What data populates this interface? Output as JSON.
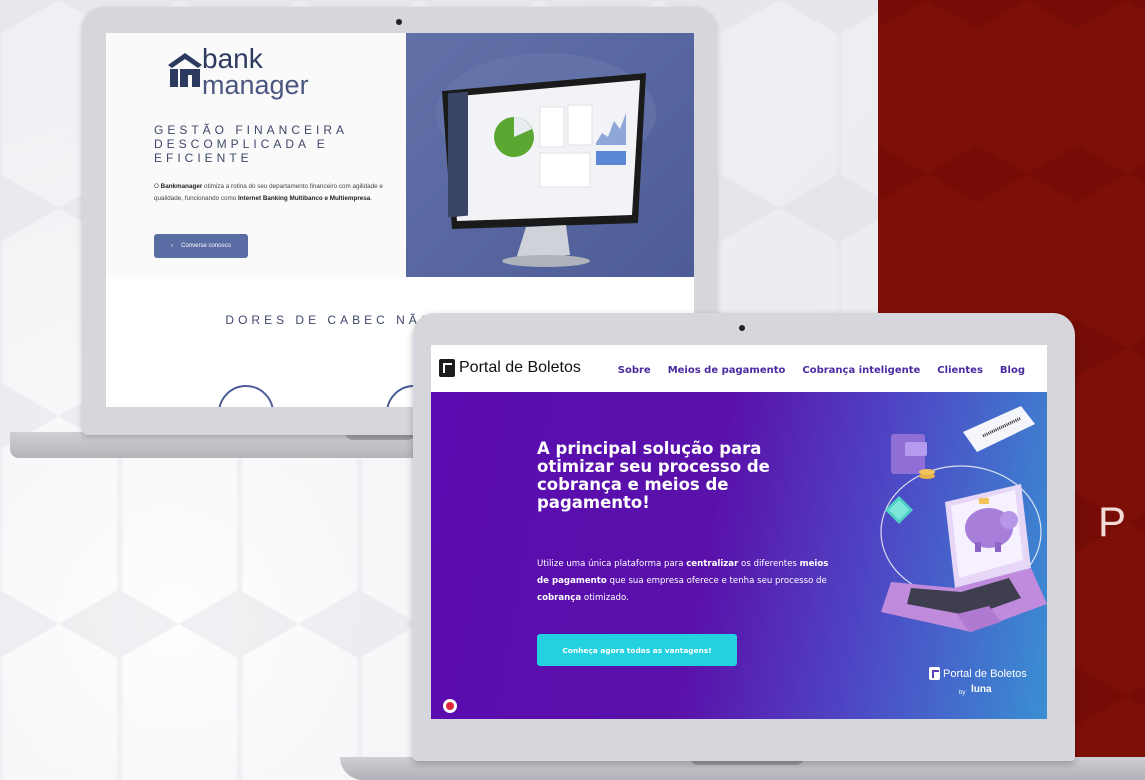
{
  "bankmanager": {
    "logo_line1": "bank",
    "logo_line2": "manager",
    "tagline": "GESTÃO FINANCEIRA DESCOMPLICADA E EFICIENTE",
    "description_parts": {
      "p1": "O ",
      "b1": "Bankmanager",
      "p2": " otimiza a rotina do seu departamento financeiro com agilidade e qualidade, funcionando como ",
      "b2": "Internet Banking Multibanco e Multiempresa",
      "p3": "."
    },
    "cta_label": "Converse conosco",
    "section_title": "DORES DE CABEC NÃO TEM UM SISTE"
  },
  "portal": {
    "logo_text": "Portal de Boletos",
    "nav": [
      "Sobre",
      "Meios de pagamento",
      "Cobrança inteligente",
      "Clientes",
      "Blog"
    ],
    "headline": "A principal solução para otimizar seu processo de cobrança e meios de pagamento!",
    "paragraph_parts": {
      "p1": "Utilize uma única plataforma para ",
      "b1": "centralizar",
      "p2": " os diferentes ",
      "b2": "meios de pagamento",
      "p3": " que sua empresa oferece e tenha seu processo de ",
      "b3": "cobrança",
      "p4": " otimizado."
    },
    "cta_label": "Conheça agora todas as vantagens!",
    "footer_logo_text": "Portal de Boletos",
    "footer_by": "by",
    "footer_luna": "luna"
  },
  "background": {
    "red_panel_letter": "P"
  },
  "colors": {
    "red_panel": "#7e0f07",
    "portal_purple": "#5a0bb0",
    "portal_cyan": "#23d1e0",
    "bankmanager_navy": "#4d5c96"
  }
}
